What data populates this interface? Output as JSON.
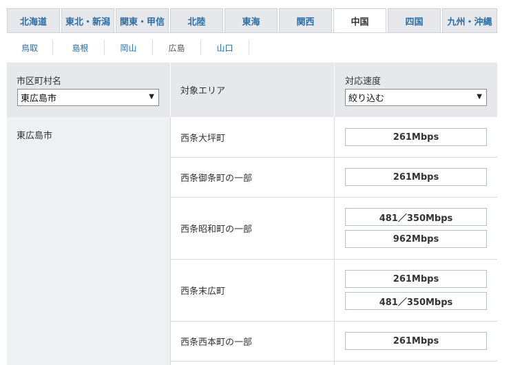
{
  "region_tabs": [
    {
      "label": "北海道",
      "active": false
    },
    {
      "label": "東北・新潟",
      "active": false
    },
    {
      "label": "関東・甲信",
      "active": false
    },
    {
      "label": "北陸",
      "active": false
    },
    {
      "label": "東海",
      "active": false
    },
    {
      "label": "関西",
      "active": false
    },
    {
      "label": "中国",
      "active": true
    },
    {
      "label": "四国",
      "active": false
    },
    {
      "label": "九州・沖縄",
      "active": false
    }
  ],
  "prefectures": [
    {
      "label": "鳥取",
      "current": false
    },
    {
      "label": "島根",
      "current": false
    },
    {
      "label": "岡山",
      "current": false
    },
    {
      "label": "広島",
      "current": true
    },
    {
      "label": "山口",
      "current": false
    }
  ],
  "table": {
    "headers": {
      "city": "市区町村名",
      "area": "対象エリア",
      "speed": "対応速度"
    },
    "city_filter_value": "東広島市",
    "speed_filter_value": "絞り込む",
    "dropdown_arrow": "▼",
    "city": "東広島市",
    "rows": [
      {
        "area": "西条大坪町",
        "speeds": [
          "261Mbps"
        ]
      },
      {
        "area": "西条御条町の一部",
        "speeds": [
          "261Mbps"
        ]
      },
      {
        "area": "西条昭和町の一部",
        "speeds": [
          "481／350Mbps",
          "962Mbps"
        ]
      },
      {
        "area": "西条末広町",
        "speeds": [
          "261Mbps",
          "481／350Mbps"
        ]
      },
      {
        "area": "西条西本町の一部",
        "speeds": [
          "261Mbps"
        ]
      }
    ]
  }
}
